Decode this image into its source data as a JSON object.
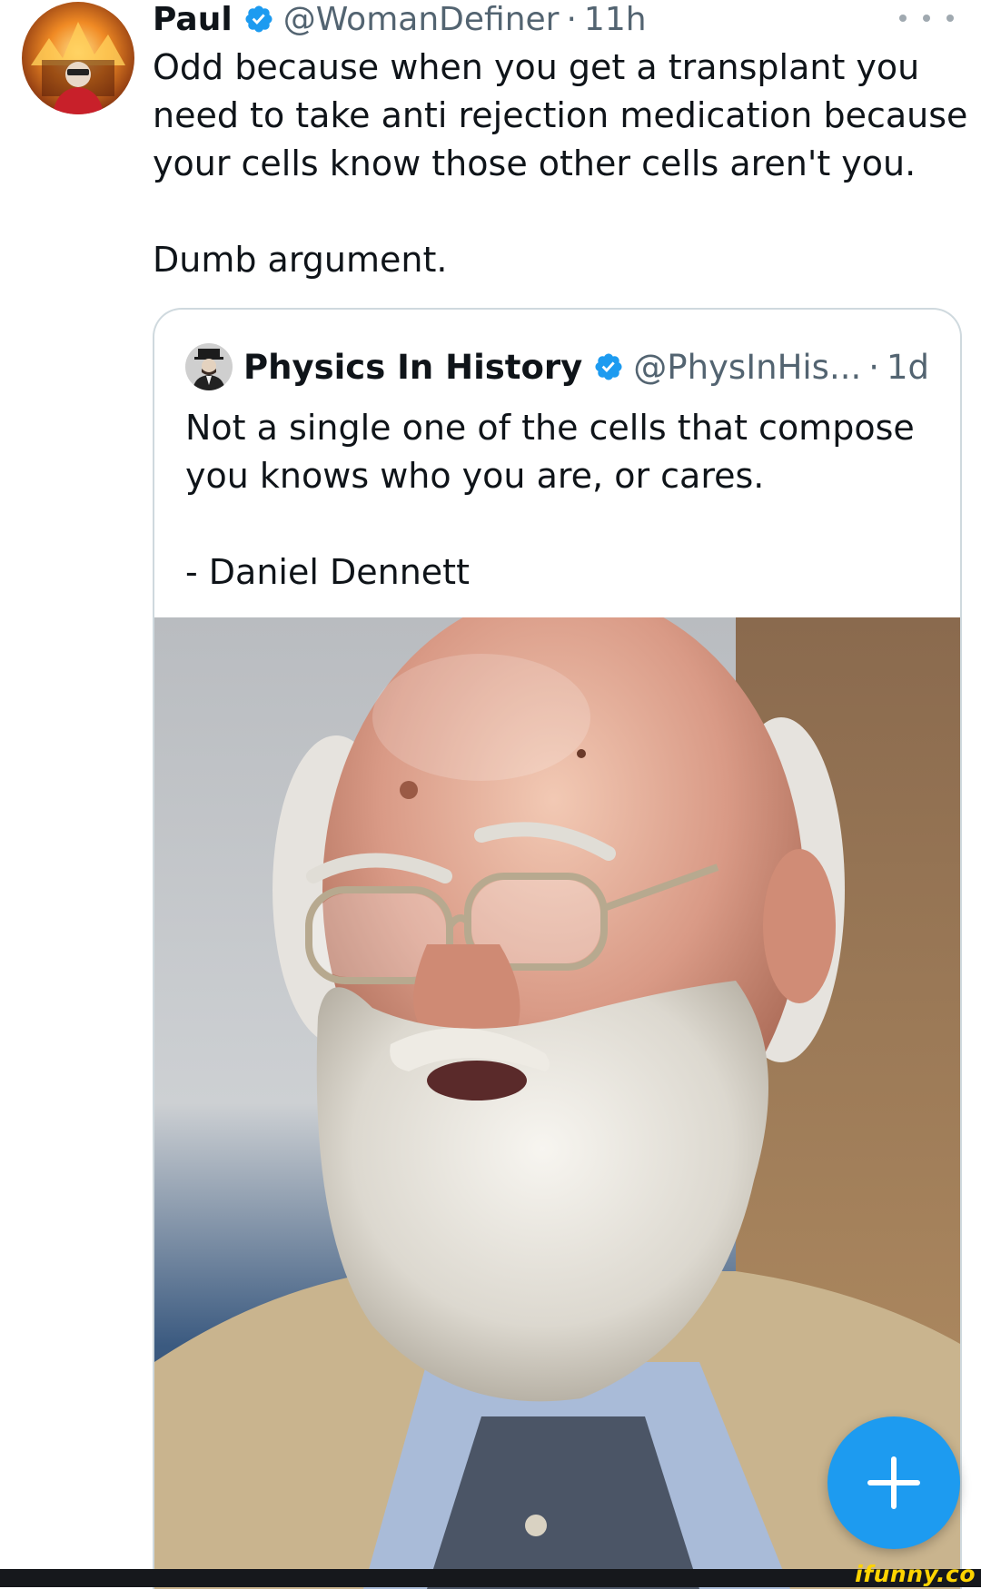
{
  "tweet": {
    "display_name": "Paul",
    "handle": "@WomanDefiner",
    "separator": "·",
    "time": "11h",
    "text": "Odd because when you get a transplant you\nneed to take anti rejection medication because\nyour cells know those other cells aren't you.\n\nDumb argument.",
    "avatar_icon": "burning-house-avatar",
    "verified_icon": "verified-badge-icon",
    "more_icon": "more-options-icon"
  },
  "quoted_tweet": {
    "display_name": "Physics In History",
    "handle": "@PhysInHis...",
    "separator": "·",
    "time": "1d",
    "text": "Not a single one of the cells that compose\nyou knows who you are, or cares.\n\n- Daniel Dennett",
    "avatar_icon": "man-in-hat-avatar",
    "verified_icon": "verified-badge-icon",
    "media_icon": "bearded-man-portrait-photo"
  },
  "compose_button": {
    "icon": "plus-icon"
  },
  "watermark": {
    "text": "ifunny.co"
  },
  "colors": {
    "accent": "#1d9bf0",
    "text": "#0f1419",
    "secondary_text": "#536471",
    "border": "#cfd9de",
    "watermark": "#ffd400"
  }
}
